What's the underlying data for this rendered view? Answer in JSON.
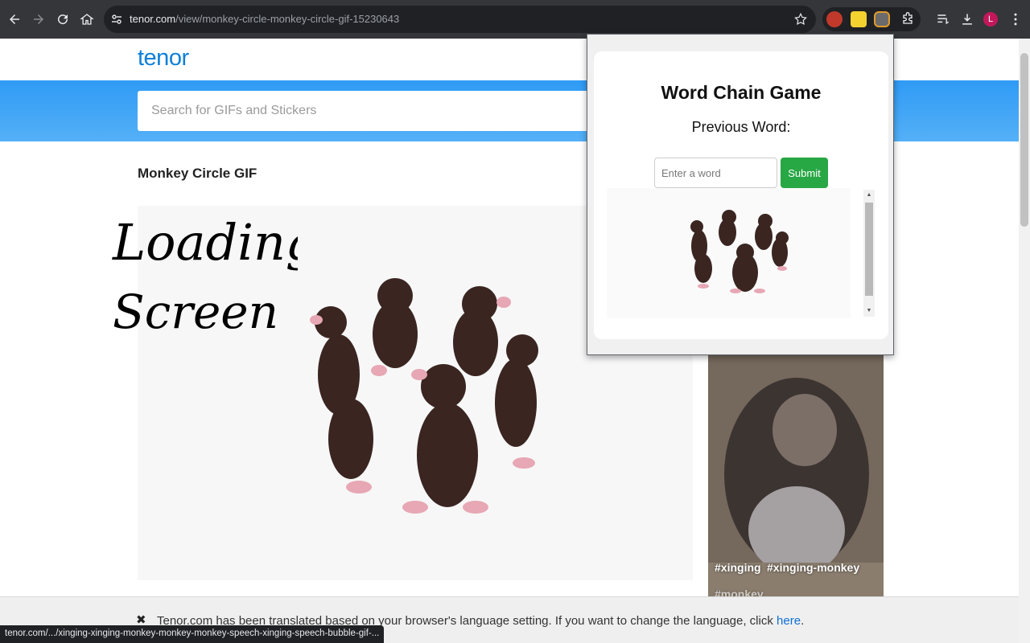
{
  "browser": {
    "url_host": "tenor.com",
    "url_path": "/view/monkey-circle-monkey-circle-gif-15230643",
    "profile_initial": "L",
    "status_url": "tenor.com/.../xinging-xinging-monkey-monkey-monkey-speech-xinging-speech-bubble-gif-..."
  },
  "site": {
    "logo": "tenor",
    "search_placeholder": "Search for GIFs and Stickers",
    "gif_title": "Monkey Circle GIF",
    "overlay_text_line1": "Loading",
    "overlay_text_line2": "Screen",
    "side_tags": [
      "#xinging",
      "#xinging-monkey",
      "#monkey"
    ]
  },
  "translate_bar": {
    "close_glyph": "✖",
    "message": "Tenor.com has been translated based on your browser's language setting. If you want to change the language, click ",
    "link": "here",
    "suffix": "."
  },
  "popup": {
    "title": "Word Chain Game",
    "previous_word_label": "Previous Word:",
    "input_placeholder": "Enter a word",
    "submit_label": "Submit"
  },
  "colors": {
    "accent_blue": "#2f9bf5",
    "submit_green": "#28a745",
    "logo_blue": "#0d7fd8"
  }
}
